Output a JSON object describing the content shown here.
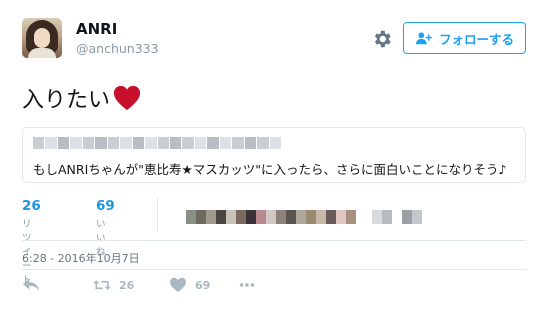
{
  "user": {
    "name": "ANRI",
    "handle": "@anchun333"
  },
  "follow_button": {
    "label": "フォローする",
    "icon": "follow-person-icon"
  },
  "tweet": {
    "text": "入りたい",
    "emoji": "heart-emoji"
  },
  "quote": {
    "text": "もしANRIちゃんが\"恵比寿★マスカッツ\"に入ったら、さらに面白いことになりそう♪"
  },
  "stats": {
    "retweets": {
      "count": "26",
      "label": "リツイート"
    },
    "likes": {
      "count": "69",
      "label": "いいね"
    }
  },
  "timestamp": "6:28 - 2016年10月7日",
  "actions": {
    "retweet_count": "26",
    "like_count": "69"
  },
  "colors": {
    "accent": "#1da1f2",
    "heart": "#c8102e",
    "muted": "#8899a6"
  }
}
